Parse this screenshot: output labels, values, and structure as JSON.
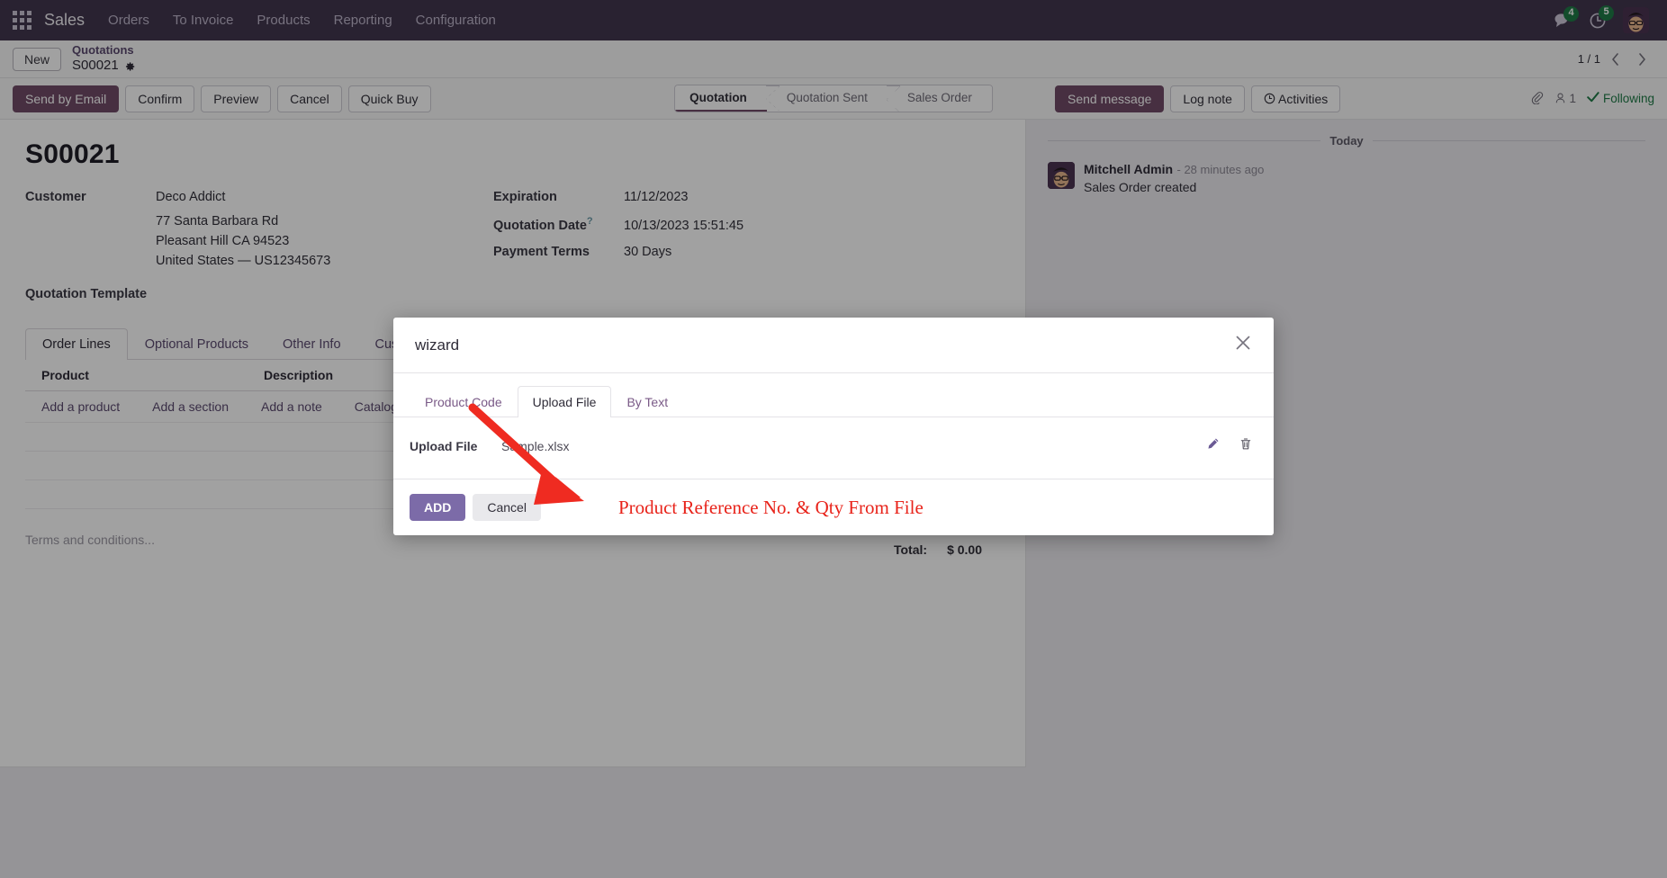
{
  "navbar": {
    "apps_icon": "apps-grid-icon",
    "brand": "Sales",
    "items": [
      "Orders",
      "To Invoice",
      "Products",
      "Reporting",
      "Configuration"
    ],
    "messages_icon": "chat-bubble-icon",
    "messages_count": "4",
    "activities_icon": "clock-icon",
    "activities_count": "5",
    "avatar_alt": "user-avatar"
  },
  "breadcrumb": {
    "new_label": "New",
    "parent": "Quotations",
    "current": "S00021",
    "settings_icon": "gear-icon",
    "pager": "1 / 1",
    "prev_icon": "chevron-left-icon",
    "next_icon": "chevron-right-icon"
  },
  "actions": {
    "buttons": [
      {
        "label": "Send by Email",
        "style": "primary"
      },
      {
        "label": "Confirm",
        "style": "secondary"
      },
      {
        "label": "Preview",
        "style": "secondary"
      },
      {
        "label": "Cancel",
        "style": "secondary"
      },
      {
        "label": "Quick Buy",
        "style": "secondary"
      }
    ]
  },
  "statusbar": {
    "stages": [
      "Quotation",
      "Quotation Sent",
      "Sales Order"
    ],
    "active": "Quotation"
  },
  "chatter_toolbar": {
    "send_message": "Send message",
    "log_note": "Log note",
    "activities": "Activities",
    "activities_icon": "clock-icon",
    "attachment_icon": "paperclip-icon",
    "followers_icon": "user-icon",
    "followers_count": "1",
    "following_icon": "check-icon",
    "following_label": "Following"
  },
  "record": {
    "title": "S00021",
    "customer_label": "Customer",
    "customer_name": "Deco Addict",
    "address_lines": [
      "77 Santa Barbara Rd",
      "Pleasant Hill CA 94523",
      "United States — US12345673"
    ],
    "quotation_template_label": "Quotation Template",
    "expiration_label": "Expiration",
    "expiration_value": "11/12/2023",
    "quotation_date_label": "Quotation Date",
    "quotation_date_help": "?",
    "quotation_date_value": "10/13/2023 15:51:45",
    "payment_terms_label": "Payment Terms",
    "payment_terms_value": "30 Days"
  },
  "form_tabs": {
    "items": [
      "Order Lines",
      "Optional Products",
      "Other Info",
      "Custo"
    ],
    "active": "Order Lines"
  },
  "order_lines": {
    "columns": [
      "Product",
      "Description"
    ],
    "actions": [
      "Add a product",
      "Add a section",
      "Add a note",
      "Catalog"
    ],
    "rows": []
  },
  "footer": {
    "terms_placeholder": "Terms and conditions...",
    "total_label": "Total:",
    "total_value": "$ 0.00"
  },
  "chatter": {
    "date_separator": "Today",
    "messages": [
      {
        "author": "Mitchell Admin",
        "time": "- 28 minutes ago",
        "body": "Sales Order created"
      }
    ]
  },
  "modal": {
    "title": "wizard",
    "close_icon": "close-icon",
    "tabs": [
      "Product Code",
      "Upload File",
      "By Text"
    ],
    "active_tab": "Upload File",
    "upload_label": "Upload File",
    "upload_filename": "Sample.xlsx",
    "edit_icon": "pencil-icon",
    "delete_icon": "trash-icon",
    "add_label": "ADD",
    "cancel_label": "Cancel"
  },
  "annotation": {
    "text": "Product Reference No. & Qty From File",
    "color": "#e8231a",
    "arrow_icon": "red-arrow-icon"
  },
  "colors": {
    "navbar": "#41364f",
    "primary": "#714b67",
    "accent_modal": "#7c6ba8",
    "badge_green": "#1f7a47",
    "annotation_red": "#e8231a"
  }
}
